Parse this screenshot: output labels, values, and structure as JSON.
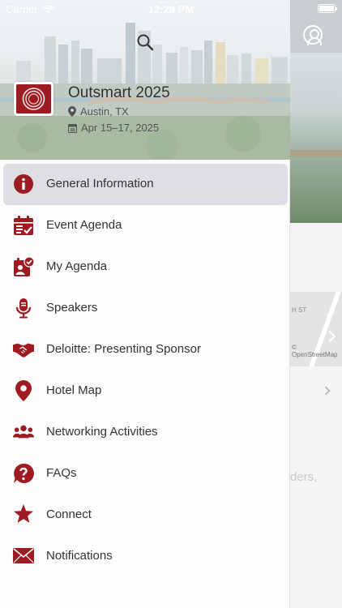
{
  "status_bar": {
    "carrier": "Carrier",
    "time": "12:29 PM"
  },
  "event": {
    "title": "Outsmart 2025",
    "location": "Austin, TX",
    "dates": "Apr 15–17, 2025"
  },
  "menu": {
    "items": [
      {
        "label": "General Information",
        "icon": "info-icon",
        "active": true
      },
      {
        "label": "Event Agenda",
        "icon": "calendar-check-icon"
      },
      {
        "label": "My Agenda",
        "icon": "personal-calendar-icon"
      },
      {
        "label": "Speakers",
        "icon": "microphone-icon"
      },
      {
        "label": "Deloitte: Presenting Sponsor",
        "icon": "handshake-icon"
      },
      {
        "label": "Hotel Map",
        "icon": "map-pin-icon"
      },
      {
        "label": "Networking Activities",
        "icon": "people-icon"
      },
      {
        "label": "FAQs",
        "icon": "question-icon"
      },
      {
        "label": "Connect",
        "icon": "star-icon"
      },
      {
        "label": "Notifications",
        "icon": "envelope-icon"
      }
    ]
  },
  "background": {
    "map_street": "H ST",
    "map_copyright": "© OpenStreetMap",
    "faded_text": "ders,"
  },
  "colors": {
    "accent": "#9e1b22",
    "active_row": "#dedfe4",
    "text": "#333333"
  }
}
